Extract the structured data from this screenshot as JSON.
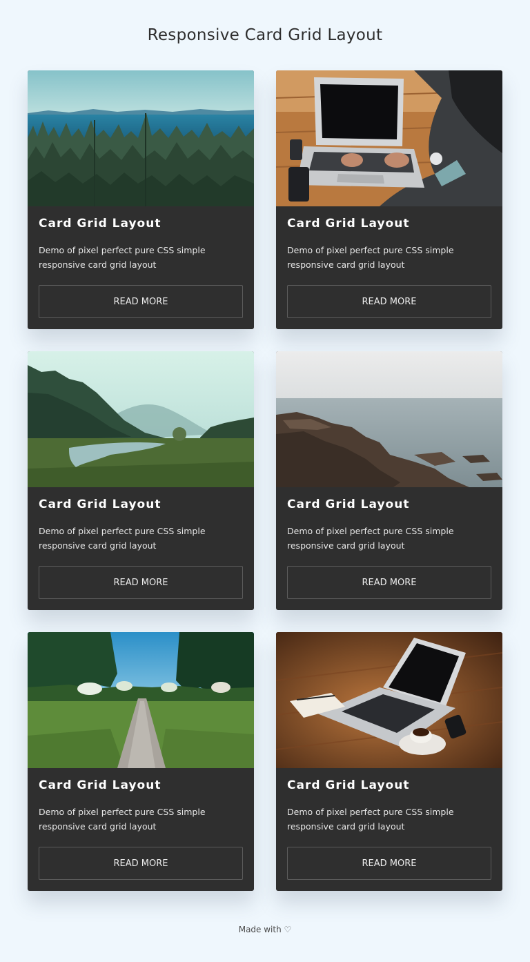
{
  "page": {
    "title": "Responsive Card Grid Layout",
    "footer": "Made with ♡"
  },
  "cards": [
    {
      "image": "forest-lake-landscape-image",
      "title": "Card Grid Layout",
      "description": "Demo of pixel perfect pure CSS simple responsive card grid layout",
      "button": "READ MORE"
    },
    {
      "image": "person-typing-on-laptop-image",
      "title": "Card Grid Layout",
      "description": "Demo of pixel perfect pure CSS simple responsive card grid layout",
      "button": "READ MORE"
    },
    {
      "image": "misty-valley-river-image",
      "title": "Card Grid Layout",
      "description": "Demo of pixel perfect pure CSS simple responsive card grid layout",
      "button": "READ MORE"
    },
    {
      "image": "rocky-seashore-image",
      "title": "Card Grid Layout",
      "description": "Demo of pixel perfect pure CSS simple responsive card grid layout",
      "button": "READ MORE"
    },
    {
      "image": "garden-path-trees-image",
      "title": "Card Grid Layout",
      "description": "Demo of pixel perfect pure CSS simple responsive card grid layout",
      "button": "READ MORE"
    },
    {
      "image": "laptop-coffee-desk-image",
      "title": "Card Grid Layout",
      "description": "Demo of pixel perfect pure CSS simple responsive card grid layout",
      "button": "READ MORE"
    }
  ],
  "colors": {
    "page_background": "#eff7fd",
    "card_background": "#2f2f2f",
    "title_text": "#2e2e2e",
    "card_text": "#ffffff",
    "button_border": "#5c5c5c"
  }
}
